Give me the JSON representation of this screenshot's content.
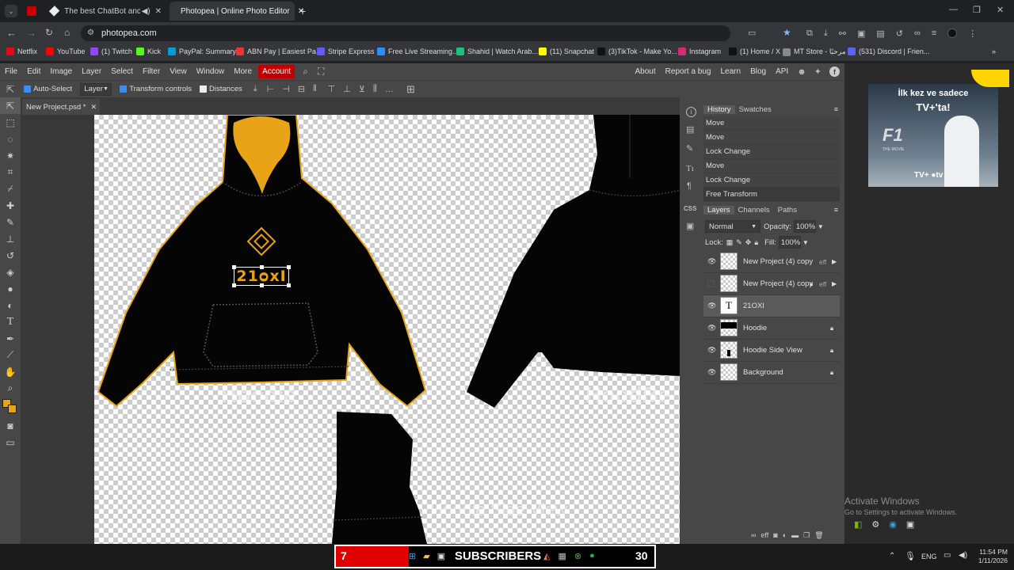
{
  "browser": {
    "tabs": [
      {
        "label": "The best ChatBot and Widg"
      },
      {
        "label": "Photopea | Online Photo Editor"
      }
    ],
    "url": "photopea.com",
    "bookmarks": [
      "Netflix",
      "YouTube",
      "(1) Twitch",
      "Kick",
      "PayPal: Summary",
      "ABN Pay | Easiest Pa...",
      "Stripe Express",
      "Free Live Streaming...",
      "Shahid | Watch Arab...",
      "(11) Snapchat",
      "(3)TikTok - Make Yo...",
      "Instagram",
      "(1) Home / X",
      "MT Store - مرحبًا",
      "(531) Discord | Frien..."
    ],
    "bookmark_colors": [
      "#e50914",
      "#ff0000",
      "#9146ff",
      "#53fc18",
      "#009cde",
      "#e33",
      "#635bff",
      "#2d8cff",
      "#19c37d",
      "#fffc00",
      "#111",
      "#d62976",
      "#111",
      "#888",
      "#5865f2"
    ]
  },
  "menu": {
    "items": [
      "File",
      "Edit",
      "Image",
      "Layer",
      "Select",
      "Filter",
      "View",
      "Window",
      "More"
    ],
    "account": "Account",
    "right_items": [
      "About",
      "Report a bug",
      "Learn",
      "Blog",
      "API"
    ]
  },
  "options": {
    "autoselect": "Auto-Select",
    "layer_select": "Layer",
    "transform_controls": "Transform controls",
    "distances": "Distances"
  },
  "document": {
    "tab_title": "New Project.psd *"
  },
  "canvas": {
    "logo_text": "21ᴑxI",
    "watermark1": "Hoodie",
    "watermark2": "HoodBe",
    "watermark3": "Hoodie Side View"
  },
  "history": {
    "tabs": [
      "History",
      "Swatches"
    ],
    "items": [
      "Move",
      "Move",
      "Lock Change",
      "Move",
      "Lock Change",
      "Free Transform"
    ]
  },
  "layers": {
    "tabs": [
      "Layers",
      "Channels",
      "Paths"
    ],
    "blend_mode": "Normal",
    "opacity_label": "Opacity:",
    "opacity": "100%",
    "lock_label": "Lock:",
    "fill_label": "Fill:",
    "fill": "100%",
    "items": [
      {
        "name": "New Project (4) copy",
        "fx": "eff"
      },
      {
        "name": "New Project (4) copy",
        "fx": "eff"
      },
      {
        "name": "21OXI",
        "fx": ""
      },
      {
        "name": "Hoodie",
        "fx": ""
      },
      {
        "name": "Hoodie Side View",
        "fx": ""
      },
      {
        "name": "Background",
        "fx": ""
      }
    ]
  },
  "ad": {
    "line1": "İlk kez ve sadece",
    "line2": "TV+'ta!",
    "movie": "F1",
    "movie_sub": "THE MOVIE",
    "brand": "TV+ ●tv"
  },
  "windows_watermark": {
    "title": "Activate Windows",
    "subtitle": "Go to Settings to activate Windows."
  },
  "taskbar": {
    "widget_left": "7",
    "widget_text": "SUBSCRIBERS",
    "widget_right": "30",
    "lang": "ENG",
    "time": "11:54 PM",
    "date": "1/11/2026"
  },
  "colors": {
    "accent_red": "#c00000",
    "logo_orange": "#e8a317",
    "foreground_color": "#e8a317"
  }
}
